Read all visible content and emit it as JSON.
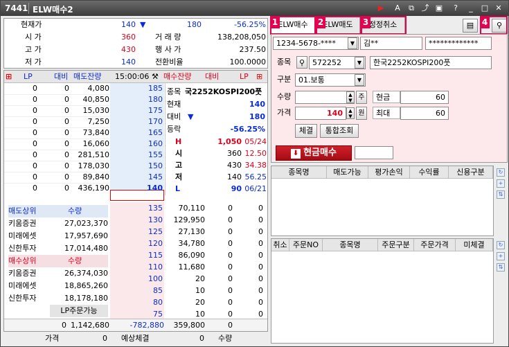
{
  "window": {
    "code": "7441",
    "title": "ELW매수2"
  },
  "quote": {
    "rows": [
      {
        "l1": "현재가",
        "v1": "140",
        "arrow": "▼",
        "v2": "180",
        "pct": "-56.25%"
      },
      {
        "l1": "시    가",
        "v1": "360",
        "l2": "거 래 량",
        "v2": "138,208,050"
      },
      {
        "l1": "고    가",
        "v1": "430",
        "l2": "행 사 가",
        "v2": "237.50"
      },
      {
        "l1": "저    가",
        "v1": "140",
        "l2": "전환비율",
        "v2": "100.0000"
      }
    ]
  },
  "orderbook": {
    "headers": {
      "lp": "LP",
      "vs": "대비",
      "ask_qty": "매도잔량",
      "time": "15:00:06",
      "bid_qty": "매수잔량",
      "vs2": "대비",
      "lp2": "LP"
    },
    "asks": [
      {
        "lp": "0",
        "vs": "0",
        "qty": "4,080",
        "price": "185"
      },
      {
        "lp": "0",
        "vs": "0",
        "qty": "40,850",
        "price": "180"
      },
      {
        "lp": "0",
        "vs": "0",
        "qty": "15,030",
        "price": "175"
      },
      {
        "lp": "0",
        "vs": "0",
        "qty": "7,250",
        "price": "170"
      },
      {
        "lp": "0",
        "vs": "0",
        "qty": "73,840",
        "price": "165"
      },
      {
        "lp": "0",
        "vs": "0",
        "qty": "16,060",
        "price": "160"
      },
      {
        "lp": "0",
        "vs": "0",
        "qty": "281,510",
        "price": "155"
      },
      {
        "lp": "0",
        "vs": "0",
        "qty": "178,030",
        "price": "150"
      },
      {
        "lp": "0",
        "vs": "0",
        "qty": "89,840",
        "price": "145"
      },
      {
        "lp": "0",
        "vs": "0",
        "qty": "436,190",
        "price": "140"
      }
    ],
    "bids": [
      {
        "price": "135",
        "qty": "70,110",
        "vs": "0",
        "lp": "0"
      },
      {
        "price": "130",
        "qty": "129,950",
        "vs": "0",
        "lp": "0"
      },
      {
        "price": "125",
        "qty": "27,130",
        "vs": "0",
        "lp": "0"
      },
      {
        "price": "120",
        "qty": "34,780",
        "vs": "0",
        "lp": "0"
      },
      {
        "price": "115",
        "qty": "86,090",
        "vs": "0",
        "lp": "0"
      },
      {
        "price": "110",
        "qty": "11,680",
        "vs": "0",
        "lp": "0"
      },
      {
        "price": "100",
        "qty": "20",
        "vs": "0",
        "lp": "0"
      },
      {
        "price": "85",
        "qty": "10",
        "vs": "0",
        "lp": "0"
      },
      {
        "price": "80",
        "qty": "20",
        "vs": "0",
        "lp": "0"
      },
      {
        "price": "75",
        "qty": "10",
        "vs": "0",
        "lp": "0"
      }
    ],
    "info": [
      {
        "k": "종목",
        "v": "국2252KOSPI200풋"
      },
      {
        "k": "현재",
        "v": "140"
      },
      {
        "k": "대비",
        "v": "180",
        "arrow": "▼"
      },
      {
        "k": "등락",
        "v": "-56.25%"
      }
    ],
    "info2": [
      {
        "k": "H",
        "a": "1,050",
        "b": "05/24"
      },
      {
        "k": "시",
        "a": "360",
        "b": "12.50"
      },
      {
        "k": "고",
        "a": "430",
        "b": "34.38"
      },
      {
        "k": "저",
        "a": "140",
        "b": "56.25"
      },
      {
        "k": "L",
        "a": "90",
        "b": "06/21"
      }
    ],
    "sell_top": {
      "title": "매도상위",
      "qty": "수량",
      "rows": [
        {
          "n": "키움증권",
          "q": "27,023,370"
        },
        {
          "n": "미래에셋",
          "q": "17,957,690"
        },
        {
          "n": "신한투자",
          "q": "17,014,480"
        }
      ]
    },
    "buy_top": {
      "title": "매수상위",
      "qty": "수량",
      "rows": [
        {
          "n": "키움증권",
          "q": "26,374,030"
        },
        {
          "n": "미래에셋",
          "q": "18,865,260"
        },
        {
          "n": "신한투자",
          "q": "18,178,180"
        }
      ]
    },
    "lp_order": "LP주문가능",
    "totals": {
      "a": "0",
      "b": "1,142,680",
      "diff": "-782,880",
      "c": "359,800",
      "d": "0"
    },
    "bottom": {
      "price_l": "가격",
      "price_v": "0",
      "exp_l": "예상체결",
      "exp_v": "0",
      "qty_l": "수량"
    }
  },
  "order": {
    "tabs": [
      "ELW매수",
      "ELW매도",
      "정정취소"
    ],
    "badges": [
      "1",
      "2",
      "3",
      "4"
    ],
    "account": "1234-5678-****",
    "name": "김**",
    "password": "*************",
    "stock_label": "종목",
    "stock_code": "572252",
    "stock_name": "한국2252KOSPI200풋",
    "type_label": "구분",
    "type_value": "01.보통",
    "qty_label": "수량",
    "qty_unit": "주",
    "cash_label": "현금",
    "cash_value": "60",
    "price_label": "가격",
    "price_value": "140",
    "price_unit": "원",
    "max_label": "최대",
    "max_value": "60",
    "btn_fill": "체결",
    "btn_inquiry": "통합조회",
    "buy_button": "현금매수"
  },
  "holdings": {
    "cols": [
      "종목명",
      "매도가능",
      "평가손익",
      "수익률",
      "신용구분"
    ]
  },
  "pending": {
    "cols": [
      "취소",
      "주문NO",
      "종목명",
      "주문구분",
      "주문가격",
      "미체결"
    ]
  }
}
